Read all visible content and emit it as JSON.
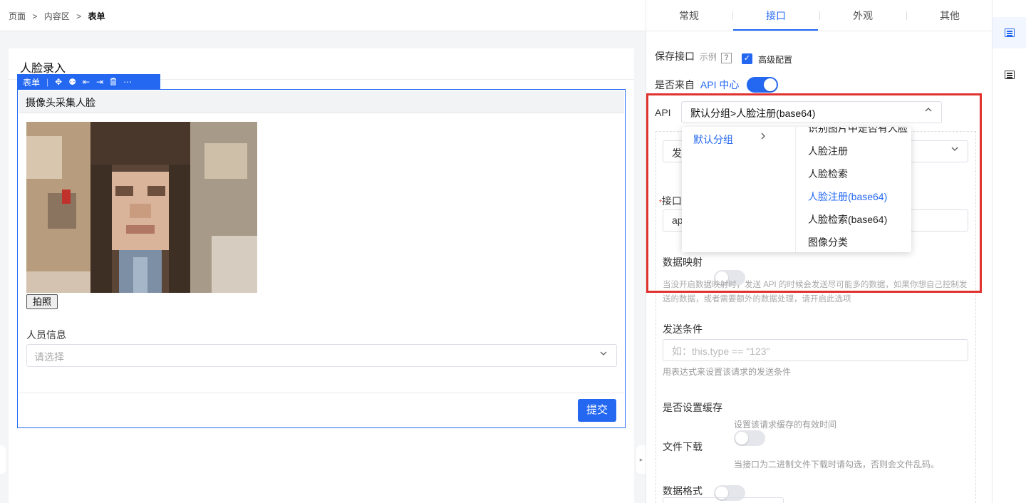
{
  "breadcrumb": {
    "items": [
      "页面",
      "内容区"
    ],
    "current": "表单",
    "separator": ">"
  },
  "page": {
    "title": "人脸录入"
  },
  "form_toolbar": {
    "label": "表单",
    "icons": [
      "move-icon",
      "bug-icon",
      "align-left-icon",
      "align-right-icon",
      "delete-icon",
      "more-icon"
    ],
    "glyphs": [
      "✥",
      "⚉",
      "⇤",
      "⇥",
      "🗑",
      "⋯"
    ]
  },
  "form": {
    "camera_title": "摄像头采集人脸",
    "snap_label": "拍照",
    "person_label": "人员信息",
    "person_placeholder": "请选择",
    "submit_label": "提交"
  },
  "tabs": [
    {
      "label": "常规",
      "active": false
    },
    {
      "label": "接口",
      "active": true
    },
    {
      "label": "外观",
      "active": false
    },
    {
      "label": "其他",
      "active": false
    }
  ],
  "settings": {
    "save_api_label": "保存接口",
    "example_label": "示例",
    "help_glyph": "?",
    "advanced_label": "高级配置",
    "advanced_checked": true,
    "from_api_center_prefix": "是否来自",
    "from_api_center_link": "API 中心",
    "from_api_center_on": true,
    "api_label": "API",
    "api_value": "默认分组>人脸注册(base64)",
    "send_label_partial": "发",
    "url_label_partial": "接口",
    "url_value_partial": "ap",
    "data_mapping_label": "数据映射",
    "data_mapping_on": false,
    "data_mapping_hint": "当没开启数据映射时，发送 API 的时候会发送尽可能多的数据，如果你想自己控制发送的数据，或者需要额外的数据处理，请开启此选项",
    "send_condition_label": "发送条件",
    "send_condition_placeholder": "如：this.type == \"123\"",
    "send_condition_hint": "用表达式来设置该请求的发送条件",
    "cache_label": "是否设置缓存",
    "cache_on": false,
    "cache_hint": "设置该请求缓存的有效时间",
    "download_label": "文件下载",
    "download_on": false,
    "download_hint": "当接口为二进制文件下载时请勾选，否则会文件乱码。",
    "data_format_label": "数据格式"
  },
  "cascader": {
    "group": "默认分组",
    "items": [
      "识别图片中是否有人脸",
      "人脸注册",
      "人脸检索",
      "人脸注册(base64)",
      "人脸检索(base64)",
      "图像分类"
    ],
    "selected": "人脸注册(base64)"
  },
  "colors": {
    "accent": "#2468f2",
    "highlight": "#e0322e"
  }
}
